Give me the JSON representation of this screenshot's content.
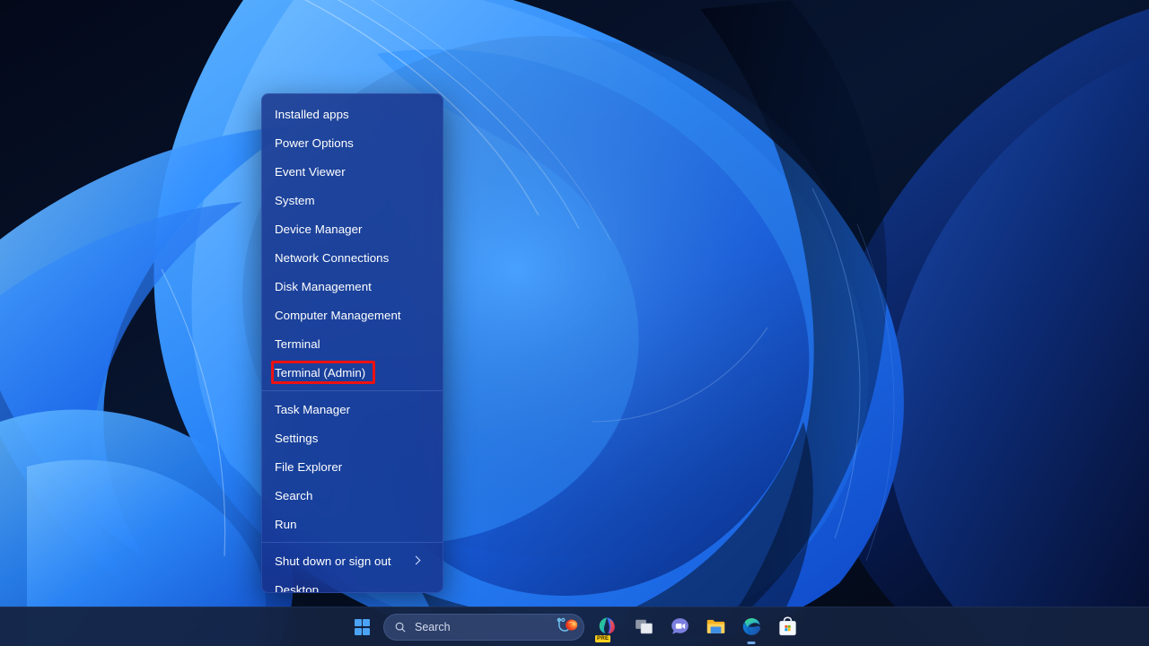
{
  "desktop": {
    "wallpaper_name": "windows-11-bloom-wallpaper",
    "colors": {
      "bg_dark": "#050d1c",
      "bg_mid": "#0d1f3f",
      "ribbon_bright": "#1f7bf2",
      "ribbon_light": "#56a8ff",
      "ribbon_deep": "#0b2f8a",
      "highlight_red": "#ee1111",
      "taskbar_bg": "#142240",
      "accent_blue": "#4aa3f5"
    }
  },
  "context_menu": {
    "name": "Win+X quick link menu",
    "highlighted_item": "Terminal (Admin)",
    "groups": [
      {
        "items": [
          {
            "label": "Installed apps",
            "name": "installed-apps",
            "submenu": false
          },
          {
            "label": "Power Options",
            "name": "power-options",
            "submenu": false
          },
          {
            "label": "Event Viewer",
            "name": "event-viewer",
            "submenu": false
          },
          {
            "label": "System",
            "name": "system",
            "submenu": false
          },
          {
            "label": "Device Manager",
            "name": "device-manager",
            "submenu": false
          },
          {
            "label": "Network Connections",
            "name": "network-connections",
            "submenu": false
          },
          {
            "label": "Disk Management",
            "name": "disk-management",
            "submenu": false
          },
          {
            "label": "Computer Management",
            "name": "computer-management",
            "submenu": false
          },
          {
            "label": "Terminal",
            "name": "terminal",
            "submenu": false
          },
          {
            "label": "Terminal (Admin)",
            "name": "terminal-admin",
            "submenu": false,
            "highlighted": true
          }
        ]
      },
      {
        "items": [
          {
            "label": "Task Manager",
            "name": "task-manager",
            "submenu": false
          },
          {
            "label": "Settings",
            "name": "settings",
            "submenu": false
          },
          {
            "label": "File Explorer",
            "name": "file-explorer",
            "submenu": false
          },
          {
            "label": "Search",
            "name": "search",
            "submenu": false
          },
          {
            "label": "Run",
            "name": "run",
            "submenu": false
          }
        ]
      },
      {
        "items": [
          {
            "label": "Shut down or sign out",
            "name": "shut-down-or-sign-out",
            "submenu": true
          },
          {
            "label": "Desktop",
            "name": "desktop",
            "submenu": false
          }
        ]
      }
    ]
  },
  "taskbar": {
    "start_button_label": "Start",
    "search": {
      "placeholder": "Search",
      "value": "Search",
      "icon": "search-icon",
      "trailing_icon": "copilot-icon"
    },
    "items": [
      {
        "name": "microsoft-365-copilot-icon",
        "label": "Microsoft 365 Copilot",
        "badge": "PRE",
        "running": false
      },
      {
        "name": "task-view-icon",
        "label": "Task view",
        "running": false
      },
      {
        "name": "microsoft-teams-icon",
        "label": "Microsoft Teams",
        "running": false
      },
      {
        "name": "file-explorer-icon",
        "label": "File Explorer",
        "running": false
      },
      {
        "name": "microsoft-edge-icon",
        "label": "Microsoft Edge",
        "running": true
      },
      {
        "name": "microsoft-store-icon",
        "label": "Microsoft Store",
        "running": false
      }
    ]
  }
}
